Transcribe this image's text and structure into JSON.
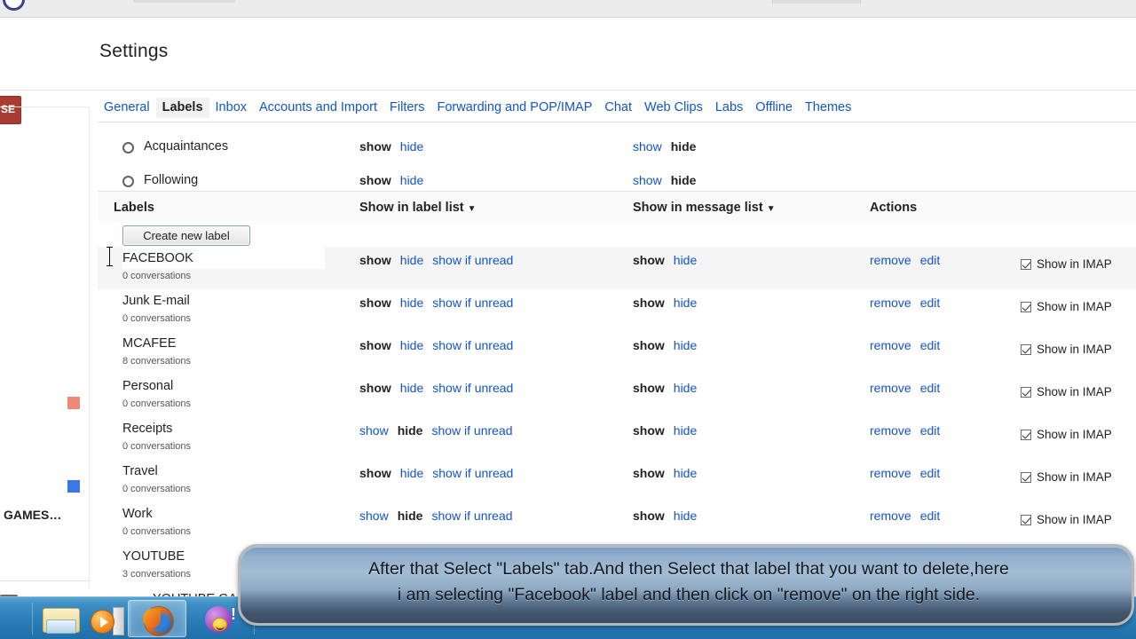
{
  "browser": {
    "tab_placeholder": ""
  },
  "header": {
    "title": "Settings"
  },
  "tabs": [
    {
      "label": "General",
      "active": false
    },
    {
      "label": "Labels",
      "active": true
    },
    {
      "label": "Inbox",
      "active": false
    },
    {
      "label": "Accounts and Import",
      "active": false
    },
    {
      "label": "Filters",
      "active": false
    },
    {
      "label": "Forwarding and POP/IMAP",
      "active": false
    },
    {
      "label": "Chat",
      "active": false
    },
    {
      "label": "Web Clips",
      "active": false
    },
    {
      "label": "Labs",
      "active": false
    },
    {
      "label": "Offline",
      "active": false
    },
    {
      "label": "Themes",
      "active": false
    }
  ],
  "circles": [
    {
      "name": "Acquaintances",
      "label_list": {
        "show": "show",
        "hide": "hide",
        "active": "show"
      },
      "message_list": {
        "show": "show",
        "hide": "hide",
        "active": "hide"
      }
    },
    {
      "name": "Following",
      "label_list": {
        "show": "show",
        "hide": "hide",
        "active": "show"
      },
      "message_list": {
        "show": "show",
        "hide": "hide",
        "active": "hide"
      }
    }
  ],
  "columns": {
    "labels": "Labels",
    "show_in_label_list": "Show in label list",
    "show_in_message_list": "Show in message list",
    "actions": "Actions",
    "caret": "▼"
  },
  "buttons": {
    "create_new_label": "Create new label"
  },
  "link_text": {
    "show": "show",
    "hide": "hide",
    "show_if_unread": "show if unread",
    "remove": "remove",
    "edit": "edit",
    "show_in_imap": "Show in IMAP"
  },
  "labels": [
    {
      "name": "FACEBOOK",
      "conversations": "0 conversations",
      "label_list_active": "show",
      "message_list_active": "show",
      "imap_checked": true,
      "selected": true,
      "indent": false
    },
    {
      "name": "Junk E-mail",
      "conversations": "0 conversations",
      "label_list_active": "show",
      "message_list_active": "show",
      "imap_checked": true,
      "selected": false,
      "indent": false
    },
    {
      "name": "MCAFEE",
      "conversations": "8 conversations",
      "label_list_active": "show",
      "message_list_active": "show",
      "imap_checked": true,
      "selected": false,
      "indent": false
    },
    {
      "name": "Personal",
      "conversations": "0 conversations",
      "label_list_active": "show",
      "message_list_active": "show",
      "imap_checked": true,
      "selected": false,
      "indent": false
    },
    {
      "name": "Receipts",
      "conversations": "0 conversations",
      "label_list_active": "hide",
      "message_list_active": "show",
      "imap_checked": true,
      "selected": false,
      "indent": false
    },
    {
      "name": "Travel",
      "conversations": "0 conversations",
      "label_list_active": "show",
      "message_list_active": "show",
      "imap_checked": true,
      "selected": false,
      "indent": false
    },
    {
      "name": "Work",
      "conversations": "0 conversations",
      "label_list_active": "hide",
      "message_list_active": "show",
      "imap_checked": true,
      "selected": false,
      "indent": false
    },
    {
      "name": "YOUTUBE",
      "conversations": "3 conversations",
      "label_list_active": "",
      "message_list_active": "",
      "imap_checked": false,
      "selected": false,
      "indent": false
    },
    {
      "name": "YOUTUBE GAMES",
      "conversations": "",
      "label_list_active": "",
      "message_list_active": "",
      "imap_checked": false,
      "selected": false,
      "indent": true
    }
  ],
  "left_rail": {
    "red_button_fragment": "SE",
    "paren_fragment": ")",
    "games_fragment": "GAMES…",
    "swatch_red": "#f08878",
    "swatch_blue": "#3b78e7"
  },
  "caption": {
    "text": "After that Select \"Labels\" tab.And then Select that label that you want to delete,here\ni am selecting \"Facebook\" label and then click on \"remove\" on the right side."
  },
  "taskbar": {
    "items": [
      {
        "icon": "folder-icon",
        "active": false
      },
      {
        "icon": "media-player-icon",
        "active": false
      },
      {
        "icon": "firefox-icon",
        "active": true
      },
      {
        "icon": "yahoo-messenger-icon",
        "active": false
      }
    ]
  },
  "colors": {
    "link": "#1155cc",
    "accent_red": "#a83c32",
    "taskbar": "#2a7db8"
  }
}
